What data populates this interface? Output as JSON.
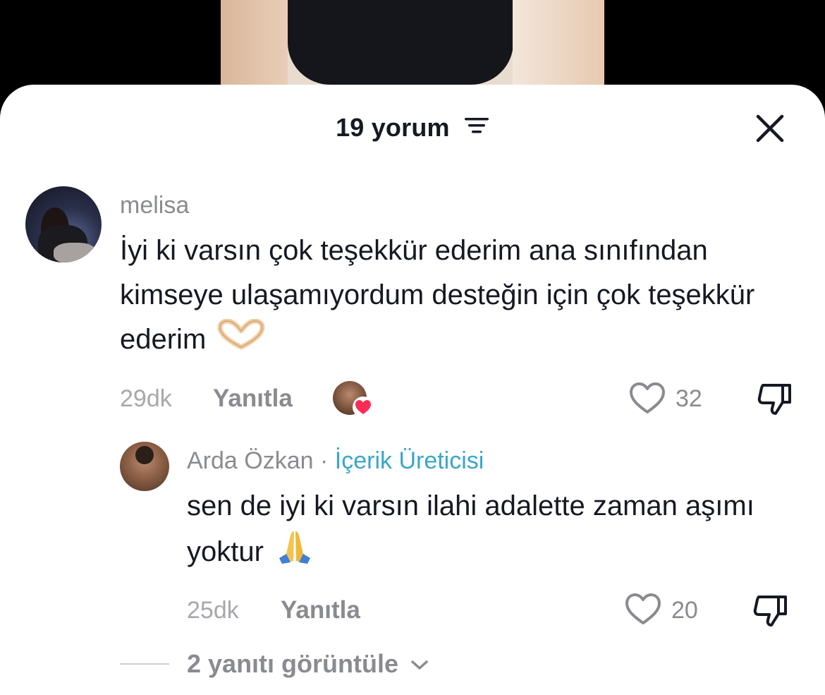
{
  "header": {
    "comment_count": "19 yorum"
  },
  "comments": [
    {
      "username": "melisa",
      "text": "İyi ki varsın çok teşekkür ederim ana sınıfından kimseye ulaşamıyordum desteğin için çok teşekkür ederim",
      "emoji_icon": "heart-hands-icon",
      "time": "29dk",
      "reply_label": "Yanıtla",
      "likes": "32",
      "liked_by_creator": true
    },
    {
      "username": "Arda Özkan",
      "separator": "·",
      "badge": "İçerik Üreticisi",
      "text": "sen de iyi ki varsın ilahi adalette zaman aşımı yoktur",
      "emoji_icon": "folded-hands-icon",
      "time": "25dk",
      "reply_label": "Yanıtla",
      "likes": "20"
    }
  ],
  "view_replies": "2 yanıtı görüntüle",
  "colors": {
    "creator_badge": "#3aa6c9",
    "heart": "#fe2c55",
    "muted": "#8a8b91"
  }
}
